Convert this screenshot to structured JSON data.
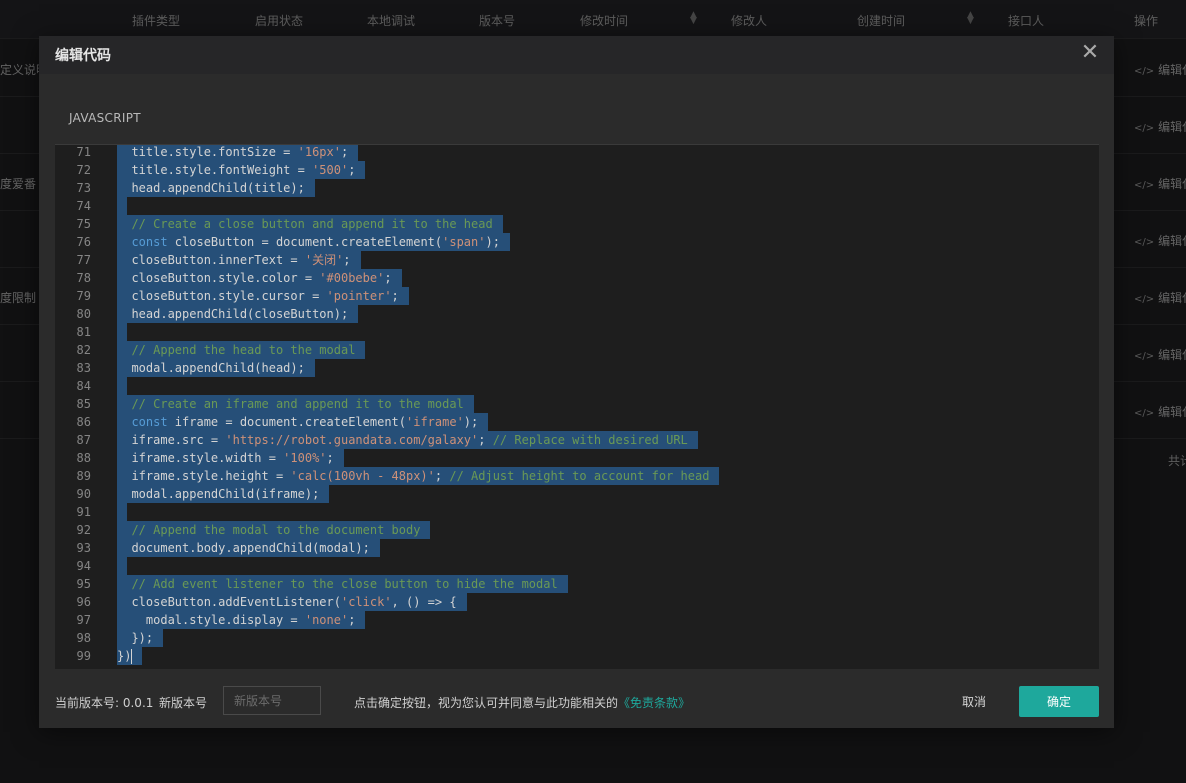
{
  "table": {
    "columns": [
      {
        "label": "插件类型",
        "sortable": false
      },
      {
        "label": "启用状态",
        "sortable": false
      },
      {
        "label": "本地调试",
        "sortable": false
      },
      {
        "label": "版本号",
        "sortable": false
      },
      {
        "label": "修改时间",
        "sortable": true
      },
      {
        "label": "修改人",
        "sortable": false
      },
      {
        "label": "创建时间",
        "sortable": true
      },
      {
        "label": "接口人",
        "sortable": false
      },
      {
        "label": "操作",
        "sortable": false
      }
    ],
    "rows": [
      {
        "left_text": "定义说明",
        "action": "编辑代"
      },
      {
        "left_text": "",
        "action": "编辑代"
      },
      {
        "left_text": "度爱番",
        "action": "编辑代"
      },
      {
        "left_text": "",
        "action": "编辑代"
      },
      {
        "left_text": "度限制",
        "action": "编辑代"
      },
      {
        "left_text": "",
        "action": "编辑代"
      },
      {
        "left_text": "",
        "action": "编辑代"
      }
    ],
    "footer_text": "共计",
    "action_icon": "code-icon"
  },
  "modal": {
    "title": "编辑代码",
    "close_icon": "close-icon",
    "language_label": "JAVASCRIPT",
    "code_lines": [
      {
        "n": "71",
        "text": "  title.style.fontSize = '16px';"
      },
      {
        "n": "72",
        "text": "  title.style.fontWeight = '500';"
      },
      {
        "n": "73",
        "text": "  head.appendChild(title);"
      },
      {
        "n": "74",
        "text": ""
      },
      {
        "n": "75",
        "text": "  // Create a close button and append it to the head"
      },
      {
        "n": "76",
        "text": "  const closeButton = document.createElement('span');"
      },
      {
        "n": "77",
        "text": "  closeButton.innerText = '关闭';"
      },
      {
        "n": "78",
        "text": "  closeButton.style.color = '#00bebe';"
      },
      {
        "n": "79",
        "text": "  closeButton.style.cursor = 'pointer';"
      },
      {
        "n": "80",
        "text": "  head.appendChild(closeButton);"
      },
      {
        "n": "81",
        "text": ""
      },
      {
        "n": "82",
        "text": "  // Append the head to the modal"
      },
      {
        "n": "83",
        "text": "  modal.appendChild(head);"
      },
      {
        "n": "84",
        "text": ""
      },
      {
        "n": "85",
        "text": "  // Create an iframe and append it to the modal"
      },
      {
        "n": "86",
        "text": "  const iframe = document.createElement('iframe');"
      },
      {
        "n": "87",
        "text": "  iframe.src = 'https://robot.guandata.com/galaxy'; // Replace with desired URL"
      },
      {
        "n": "88",
        "text": "  iframe.style.width = '100%';"
      },
      {
        "n": "89",
        "text": "  iframe.style.height = 'calc(100vh - 48px)'; // Adjust height to account for head"
      },
      {
        "n": "90",
        "text": "  modal.appendChild(iframe);"
      },
      {
        "n": "91",
        "text": ""
      },
      {
        "n": "92",
        "text": "  // Append the modal to the document body"
      },
      {
        "n": "93",
        "text": "  document.body.appendChild(modal);"
      },
      {
        "n": "94",
        "text": ""
      },
      {
        "n": "95",
        "text": "  // Add event listener to the close button to hide the modal"
      },
      {
        "n": "96",
        "text": "  closeButton.addEventListener('click', () => {"
      },
      {
        "n": "97",
        "text": "    modal.style.display = 'none';"
      },
      {
        "n": "98",
        "text": "  });"
      },
      {
        "n": "99",
        "text": "})"
      }
    ],
    "footer": {
      "current_version_label": "当前版本号: 0.0.1",
      "new_version_label": "新版本号",
      "new_version_placeholder": "新版本号",
      "new_version_value": "",
      "agreement_text": "点击确定按钮，视为您认可并同意与此功能相关的",
      "agreement_link": "《免责条款》",
      "cancel_label": "取消",
      "confirm_label": "确定"
    }
  },
  "colors": {
    "accent": "#1ea89c",
    "link": "#1ea89c",
    "selection": "#264f78",
    "keyword": "#569cd6",
    "string": "#ce9178",
    "comment": "#6a9955"
  }
}
